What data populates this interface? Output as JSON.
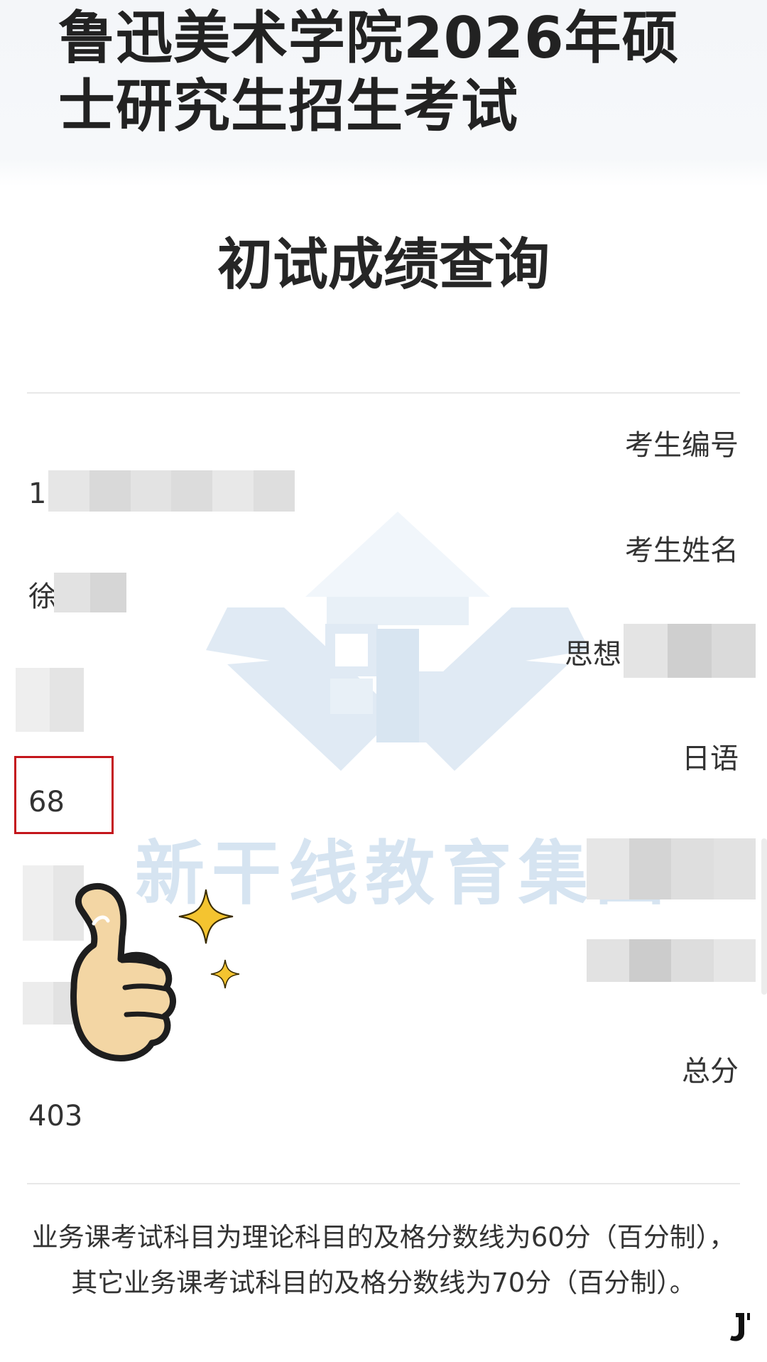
{
  "header": {
    "title": "鲁迅美术学院2026年硕士研究生招生考试"
  },
  "page_heading": "初试成绩查询",
  "fields": {
    "exam_id_label": "考生编号",
    "exam_id_value": "10",
    "name_label": "考生姓名",
    "name_value": "徐",
    "politics_label": "思想",
    "japanese_label": "日语",
    "japanese_score": "68",
    "total_label": "总分",
    "total_score": "403"
  },
  "watermark": {
    "text": "新干线教育集团"
  },
  "footer": {
    "note": "业务课考试科目为理论科目的及格分数线为60分（百分制），其它业务课考试科目的及格分数线为70分（百分制）。"
  },
  "colors": {
    "highlight": "#c4161c",
    "watermark": "#cfe0ef",
    "divider": "#e8e8e8"
  },
  "icons": [
    "thumbs-up-sticker-icon",
    "sparkle-icon",
    "watermark-logo-icon",
    "corner-logo-icon"
  ]
}
